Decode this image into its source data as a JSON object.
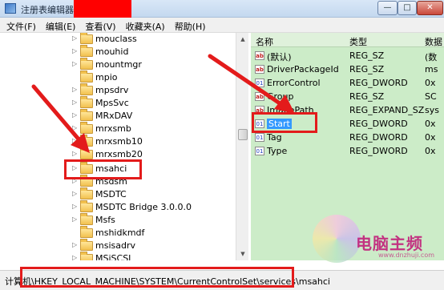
{
  "window": {
    "title": "注册表编辑器",
    "min_label": "—",
    "max_label": "□",
    "close_label": "✕"
  },
  "menu": [
    "文件(F)",
    "编辑(E)",
    "查看(V)",
    "收藏夹(A)",
    "帮助(H)"
  ],
  "tree": {
    "items": [
      "mouclass",
      "mouhid",
      "mountmgr",
      "mpio",
      "mpsdrv",
      "MpsSvc",
      "MRxDAV",
      "mrxsmb",
      "mrxsmb10",
      "mrxsmb20",
      "msahci",
      "msdsm",
      "MSDTC",
      "MSDTC Bridge 3.0.0.0",
      "Msfs",
      "mshidkmdf",
      "msisadrv",
      "MSiSCSI"
    ]
  },
  "list": {
    "headers": {
      "name": "名称",
      "type": "类型",
      "data": "数据"
    },
    "rows": [
      {
        "name": "(默认)",
        "type": "REG_SZ",
        "data": "(数",
        "icon": "string-value-icon"
      },
      {
        "name": "DriverPackageId",
        "type": "REG_SZ",
        "data": "ms",
        "icon": "string-value-icon"
      },
      {
        "name": "ErrorControl",
        "type": "REG_DWORD",
        "data": "0x",
        "icon": "dword-value-icon"
      },
      {
        "name": "Group",
        "type": "REG_SZ",
        "data": "SC",
        "icon": "string-value-icon"
      },
      {
        "name": "ImagePath",
        "type": "REG_EXPAND_SZ",
        "data": "sys",
        "icon": "string-value-icon"
      },
      {
        "name": "Start",
        "type": "REG_DWORD",
        "data": "0x",
        "icon": "dword-value-icon"
      },
      {
        "name": "Tag",
        "type": "REG_DWORD",
        "data": "0x",
        "icon": "dword-value-icon"
      },
      {
        "name": "Type",
        "type": "REG_DWORD",
        "data": "0x",
        "icon": "dword-value-icon"
      }
    ]
  },
  "status": {
    "path": "计算机\\HKEY_LOCAL_MACHINE\\SYSTEM\\CurrentControlSet\\services\\msahci"
  },
  "watermark": {
    "text": "电脑主频",
    "url": "www.dnzhuji.com"
  },
  "colors": {
    "annotation": "#e31b1b",
    "list_background": "#ccecc8",
    "selection": "#3399ff"
  }
}
